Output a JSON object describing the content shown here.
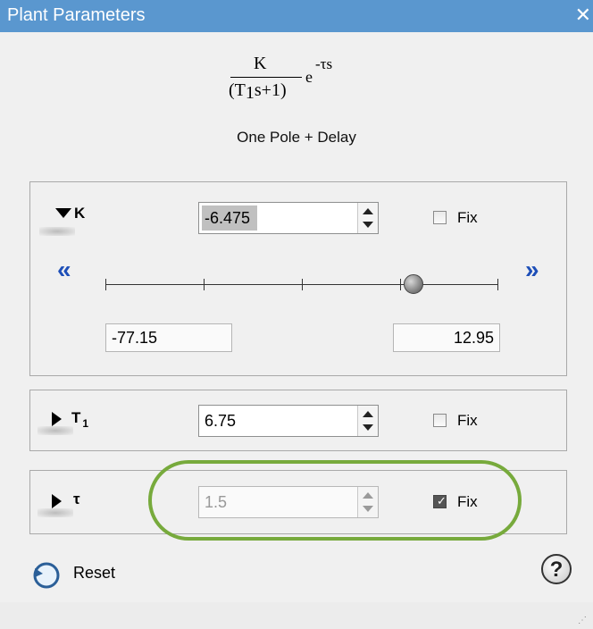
{
  "window": {
    "title": "Plant Parameters",
    "close_glyph": "✕"
  },
  "formula": {
    "numerator": "K",
    "denominator_open": "(T",
    "denominator_sub": "1",
    "denominator_rest": "s+1)",
    "exp_base": "e",
    "exp_power": "-τs"
  },
  "model_name": "One Pole + Delay",
  "params": {
    "K": {
      "label": "K",
      "value": "-6.475",
      "fix_label": "Fix",
      "fixed": false,
      "expanded": true,
      "slider": {
        "min": "-77.15",
        "max": "12.95",
        "position_fraction": 0.785
      },
      "left_nav": "«",
      "right_nav": "»"
    },
    "T1": {
      "label": "T",
      "label_sub": "1",
      "value": "6.75",
      "fix_label": "Fix",
      "fixed": false,
      "expanded": false
    },
    "tau": {
      "label": "τ",
      "value": "1.5",
      "fix_label": "Fix",
      "fixed": true,
      "enabled": false,
      "expanded": false
    }
  },
  "footer": {
    "reset_label": "Reset",
    "help_glyph": "?"
  },
  "colors": {
    "titlebar": "#5a97cf",
    "nav_arrow": "#1e4fb8",
    "highlight_ring": "#77aa3c"
  },
  "icons": [
    "close-icon",
    "expand-down-icon",
    "collapse-right-icon",
    "chevron-double-left-icon",
    "chevron-double-right-icon",
    "slider-thumb-icon",
    "reset-icon",
    "help-icon",
    "resize-grip-icon"
  ]
}
